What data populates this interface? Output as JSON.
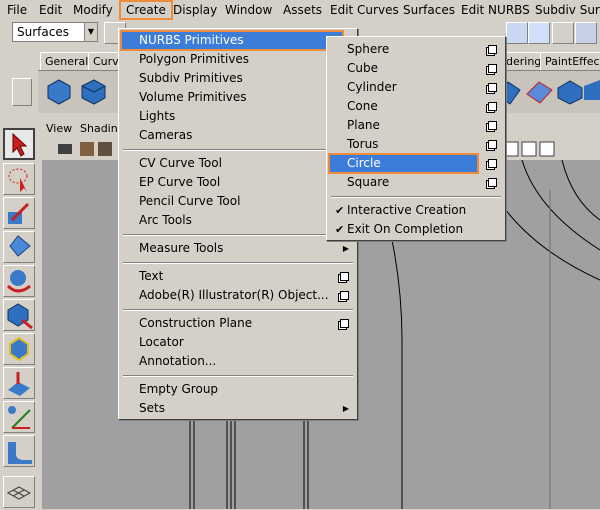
{
  "menubar": {
    "items": [
      "File",
      "Edit",
      "Modify",
      "Create",
      "Display",
      "Window",
      "Assets",
      "Edit Curves",
      "Surfaces",
      "Edit NURBS",
      "Subdiv Surfa"
    ],
    "highlighted": "Create"
  },
  "toolbar": {
    "menuset_value": "Surfaces"
  },
  "shelf": {
    "tabs": [
      "General",
      "Curve",
      "dering",
      "PaintEffects"
    ]
  },
  "panel": {
    "menu": [
      "View",
      "Shadin"
    ]
  },
  "create_menu": {
    "sections": [
      [
        {
          "label": "NURBS Primitives",
          "submenu": true,
          "active": true
        },
        {
          "label": "Polygon Primitives",
          "submenu": true
        },
        {
          "label": "Subdiv Primitives",
          "submenu": true
        },
        {
          "label": "Volume Primitives",
          "submenu": true
        },
        {
          "label": "Lights",
          "submenu": true
        },
        {
          "label": "Cameras",
          "submenu": true
        }
      ],
      [
        {
          "label": "CV Curve Tool"
        },
        {
          "label": "EP Curve Tool"
        },
        {
          "label": "Pencil Curve Tool"
        },
        {
          "label": "Arc Tools",
          "submenu": true
        }
      ],
      [
        {
          "label": "Measure Tools",
          "submenu": true
        }
      ],
      [
        {
          "label": "Text",
          "option": true
        },
        {
          "label": "Adobe(R) Illustrator(R) Object...",
          "option": true
        }
      ],
      [
        {
          "label": "Construction Plane",
          "option": true
        },
        {
          "label": "Locator"
        },
        {
          "label": "Annotation..."
        }
      ],
      [
        {
          "label": "Empty Group"
        },
        {
          "label": "Sets",
          "submenu": true
        }
      ]
    ]
  },
  "nurbs_submenu": {
    "items": [
      {
        "label": "Sphere",
        "option": true
      },
      {
        "label": "Cube",
        "option": true
      },
      {
        "label": "Cylinder",
        "option": true
      },
      {
        "label": "Cone",
        "option": true
      },
      {
        "label": "Plane",
        "option": true
      },
      {
        "label": "Torus",
        "option": true
      },
      {
        "label": "Circle",
        "option": true,
        "active": true
      },
      {
        "label": "Square",
        "option": true
      }
    ],
    "toggles": [
      {
        "label": "Interactive Creation",
        "checked": true
      },
      {
        "label": "Exit On Completion",
        "checked": true
      }
    ]
  },
  "colors": {
    "highlight": "#3b7dd8",
    "callout": "#ee8c3a",
    "viewport": "#a0a0a0"
  }
}
